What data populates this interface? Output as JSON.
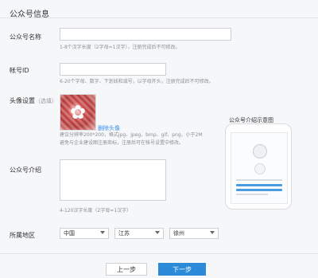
{
  "section": {
    "title": "公众号信息"
  },
  "name_field": {
    "label": "公众号名称",
    "value": "",
    "hint": "1-8个汉字长度（2字母=1汉字），注册完成后不可修改。"
  },
  "account_id_field": {
    "label": "帐号ID",
    "value": "",
    "hint": "6-20个字母、数字、下划线和减号，以字母开头，注册完成后不可修改。"
  },
  "avatar": {
    "label": "头像设置",
    "label_note": "（选填）",
    "delete_link": "删除头像",
    "hint_line1": "建议分辨率200*200，格式jpg、jpeg、bmp、gif、png，小于2M",
    "hint_line2": "避免与企业建设图注册商标，注册后可在帐号设置中修改。"
  },
  "intro_field": {
    "label": "公众号介绍",
    "value": "",
    "hint": "4-120汉字长度（2字母=1汉字）"
  },
  "region": {
    "label": "所属地区",
    "country": "中国",
    "province": "江苏",
    "city": "徐州"
  },
  "preview": {
    "title": "公众号介绍示意图"
  },
  "buttons": {
    "prev": "上一步",
    "next": "下一步"
  },
  "colors": {
    "primary": "#2b8bd9",
    "link": "#3a8ee6",
    "background": "#f6f7f9"
  }
}
